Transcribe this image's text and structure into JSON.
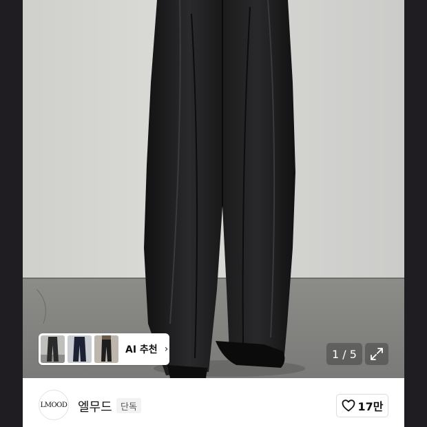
{
  "gallery": {
    "counter": "1 / 5",
    "expand_icon": "expand-icon"
  },
  "ai_recommend": {
    "label": "AI 추천",
    "chevron": "›",
    "thumbnails": [
      "recommended-pants-1",
      "recommended-pants-2",
      "recommended-pants-3"
    ]
  },
  "brand": {
    "logo_text": "LMOOD",
    "name": "엘무드",
    "badge": "단독"
  },
  "like": {
    "icon": "heart-icon",
    "count": "17만"
  }
}
